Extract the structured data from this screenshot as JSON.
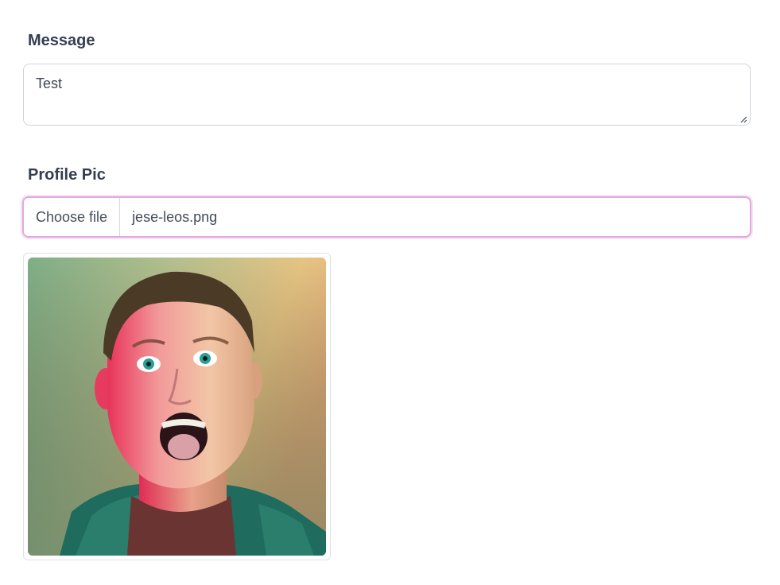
{
  "message": {
    "label": "Message",
    "value": "Test"
  },
  "profile_pic": {
    "label": "Profile Pic",
    "button_label": "Choose file",
    "file_name": "jese-leos.png"
  },
  "colors": {
    "label_text": "#343e52",
    "input_border": "#ced4da",
    "focus_border": "#e2a9df",
    "focus_ring": "#f6e3f5"
  }
}
